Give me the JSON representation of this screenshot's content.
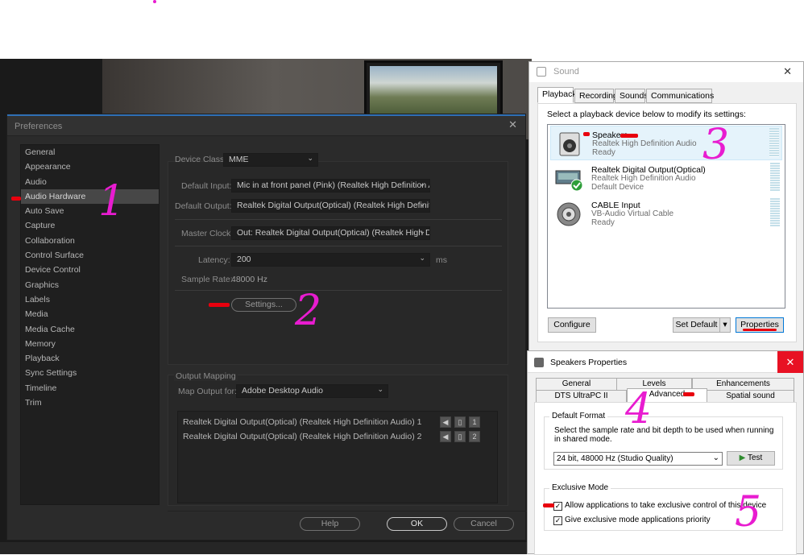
{
  "preferences": {
    "title": "Preferences",
    "close_glyph": "✕",
    "sidebar_items": [
      "General",
      "Appearance",
      "Audio",
      "Audio Hardware",
      "Auto Save",
      "Capture",
      "Collaboration",
      "Control Surface",
      "Device Control",
      "Graphics",
      "Labels",
      "Media",
      "Media Cache",
      "Memory",
      "Playback",
      "Sync Settings",
      "Timeline",
      "Trim"
    ],
    "selected_item": "Audio Hardware",
    "device_class_label": "Device Class:",
    "device_class_value": "MME",
    "default_input_label": "Default Input:",
    "default_input_value": "Mic in at front panel (Pink) (Realtek High Definition A...",
    "default_output_label": "Default Output:",
    "default_output_value": "Realtek Digital Output(Optical) (Realtek High Definit...",
    "master_clock_label": "Master Clock:",
    "master_clock_value": "Out: Realtek Digital Output(Optical) (Realtek High De...",
    "latency_label": "Latency:",
    "latency_value": "200",
    "latency_unit": "ms",
    "sample_rate_label": "Sample Rate:",
    "sample_rate_value": "48000 Hz",
    "settings_button": "Settings...",
    "output_mapping_label": "Output Mapping",
    "map_output_label": "Map Output for:",
    "map_output_value": "Adobe Desktop Audio",
    "mapping_rows": [
      {
        "label": "Realtek Digital Output(Optical) (Realtek High Definition Audio) 1",
        "num": "1"
      },
      {
        "label": "Realtek Digital Output(Optical) (Realtek High Definition Audio) 2",
        "num": "2"
      }
    ],
    "help_button": "Help",
    "ok_button": "OK",
    "cancel_button": "Cancel"
  },
  "sound": {
    "title": "Sound",
    "close_glyph": "✕",
    "tabs": [
      "Playback",
      "Recording",
      "Sounds",
      "Communications"
    ],
    "active_tab": "Playback",
    "instruction": "Select a playback device below to modify its settings:",
    "devices": [
      {
        "name": "Speakers",
        "driver": "Realtek High Definition Audio",
        "status": "Ready",
        "icon": "speaker-icon"
      },
      {
        "name": "Realtek Digital Output(Optical)",
        "driver": "Realtek High Definition Audio",
        "status": "Default Device",
        "icon": "digital-output-icon"
      },
      {
        "name": "CABLE Input",
        "driver": "VB-Audio Virtual Cable",
        "status": "Ready",
        "icon": "cable-input-icon"
      }
    ],
    "configure_button": "Configure",
    "set_default_button": "Set Default",
    "properties_button": "Properties"
  },
  "speakers_properties": {
    "title": "Speakers Properties",
    "close_glyph": "✕",
    "tabs_row1": [
      "General",
      "Levels",
      "Enhancements"
    ],
    "tabs_row2": [
      "DTS UltraPC II",
      "Advanced",
      "Spatial sound"
    ],
    "active_tab": "Advanced",
    "default_format_legend": "Default Format",
    "default_format_desc": "Select the sample rate and bit depth to be used when running in shared mode.",
    "format_value": "24 bit, 48000 Hz (Studio Quality)",
    "test_button": "Test",
    "exclusive_legend": "Exclusive Mode",
    "exclusive_allow": "Allow applications to take exclusive control of this device",
    "exclusive_priority": "Give exclusive mode applications priority",
    "allow_checked": true,
    "priority_checked": true
  },
  "annotations": [
    "1",
    "2",
    "3",
    "4",
    "5"
  ],
  "accent_colors": {
    "annotation": "#e81cd0",
    "marker": "#e8000e",
    "close_red": "#e81123"
  }
}
